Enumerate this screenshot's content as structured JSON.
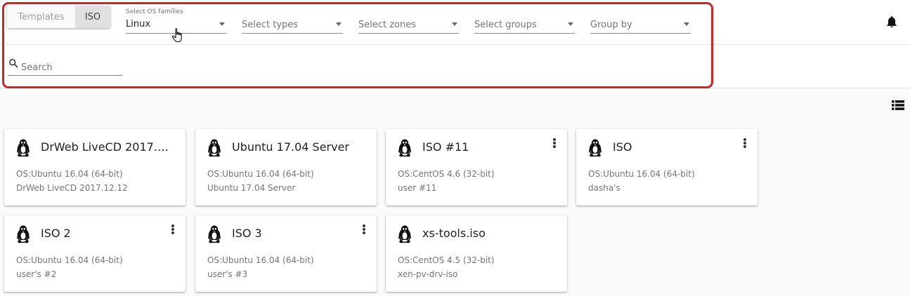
{
  "toolbar": {
    "view_toggle": {
      "templates_label": "Templates",
      "iso_label": "ISO",
      "active": "ISO"
    },
    "filters": {
      "os_families": {
        "label": "Select OS families",
        "value": "Linux"
      },
      "types": {
        "placeholder": "Select types"
      },
      "zones": {
        "placeholder": "Select zones"
      },
      "groups": {
        "placeholder": "Select groups"
      },
      "group_by": {
        "placeholder": "Group by"
      }
    },
    "search": {
      "placeholder": "Search",
      "value": ""
    }
  },
  "icons": {
    "notifications": "bell-icon",
    "view_mode": "list-view-icon",
    "card_os": "linux-tux-icon",
    "card_menu": "more-vert-icon"
  },
  "colors": {
    "highlight": "#c62828",
    "active_toggle": "#e0e0e0"
  },
  "cards": [
    {
      "title": "DrWeb LiveCD 2017.1…",
      "os": "OS:Ubuntu 16.04 (64-bit)",
      "description": "DrWeb LiveCD 2017.12.12",
      "has_menu": false
    },
    {
      "title": "Ubuntu 17.04 Server",
      "os": "OS:Ubuntu 16.04 (64-bit)",
      "description": "Ubuntu 17.04 Server",
      "has_menu": false
    },
    {
      "title": "ISO #11",
      "os": "OS:CentOS 4.6 (32-bit)",
      "description": "user #11",
      "has_menu": true
    },
    {
      "title": "ISO",
      "os": "OS:Ubuntu 16.04 (64-bit)",
      "description": "dasha's",
      "has_menu": true
    },
    {
      "title": "ISO 2",
      "os": "OS:Ubuntu 16.04 (64-bit)",
      "description": "user's #2",
      "has_menu": true
    },
    {
      "title": "ISO 3",
      "os": "OS:Ubuntu 16.04 (64-bit)",
      "description": "user's #3",
      "has_menu": true
    },
    {
      "title": "xs-tools.iso",
      "os": "OS:CentOS 4.5 (32-bit)",
      "description": "xen-pv-drv-iso",
      "has_menu": false
    }
  ]
}
